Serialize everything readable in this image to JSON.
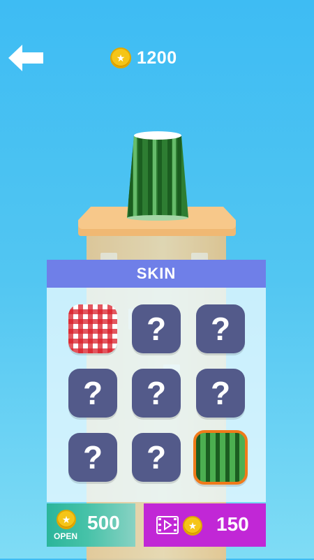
{
  "header": {
    "back_icon": "arrow-left-icon",
    "coin_icon": "star-coin-icon",
    "coins": "1200"
  },
  "panel": {
    "title": "SKIN",
    "slots": [
      {
        "kind": "red-checker-skin",
        "label": ""
      },
      {
        "kind": "locked",
        "label": "?"
      },
      {
        "kind": "locked",
        "label": "?"
      },
      {
        "kind": "locked",
        "label": "?"
      },
      {
        "kind": "locked",
        "label": "?"
      },
      {
        "kind": "locked",
        "label": "?"
      },
      {
        "kind": "locked",
        "label": "?"
      },
      {
        "kind": "locked",
        "label": "?"
      },
      {
        "kind": "watermelon-skin",
        "label": ""
      }
    ]
  },
  "buttons": {
    "open": {
      "label": "OPEN",
      "price": "500",
      "icon": "star-coin-icon"
    },
    "video": {
      "price": "150",
      "icons": [
        "video-film-icon",
        "star-coin-icon"
      ]
    }
  },
  "colors": {
    "sky": "#3ebcf3",
    "panel_header": "#6f7fe8",
    "locked_slot": "#535a8a",
    "open_button": "#2bb59b",
    "video_button": "#c127d6",
    "selected_border": "#f07a1a"
  }
}
